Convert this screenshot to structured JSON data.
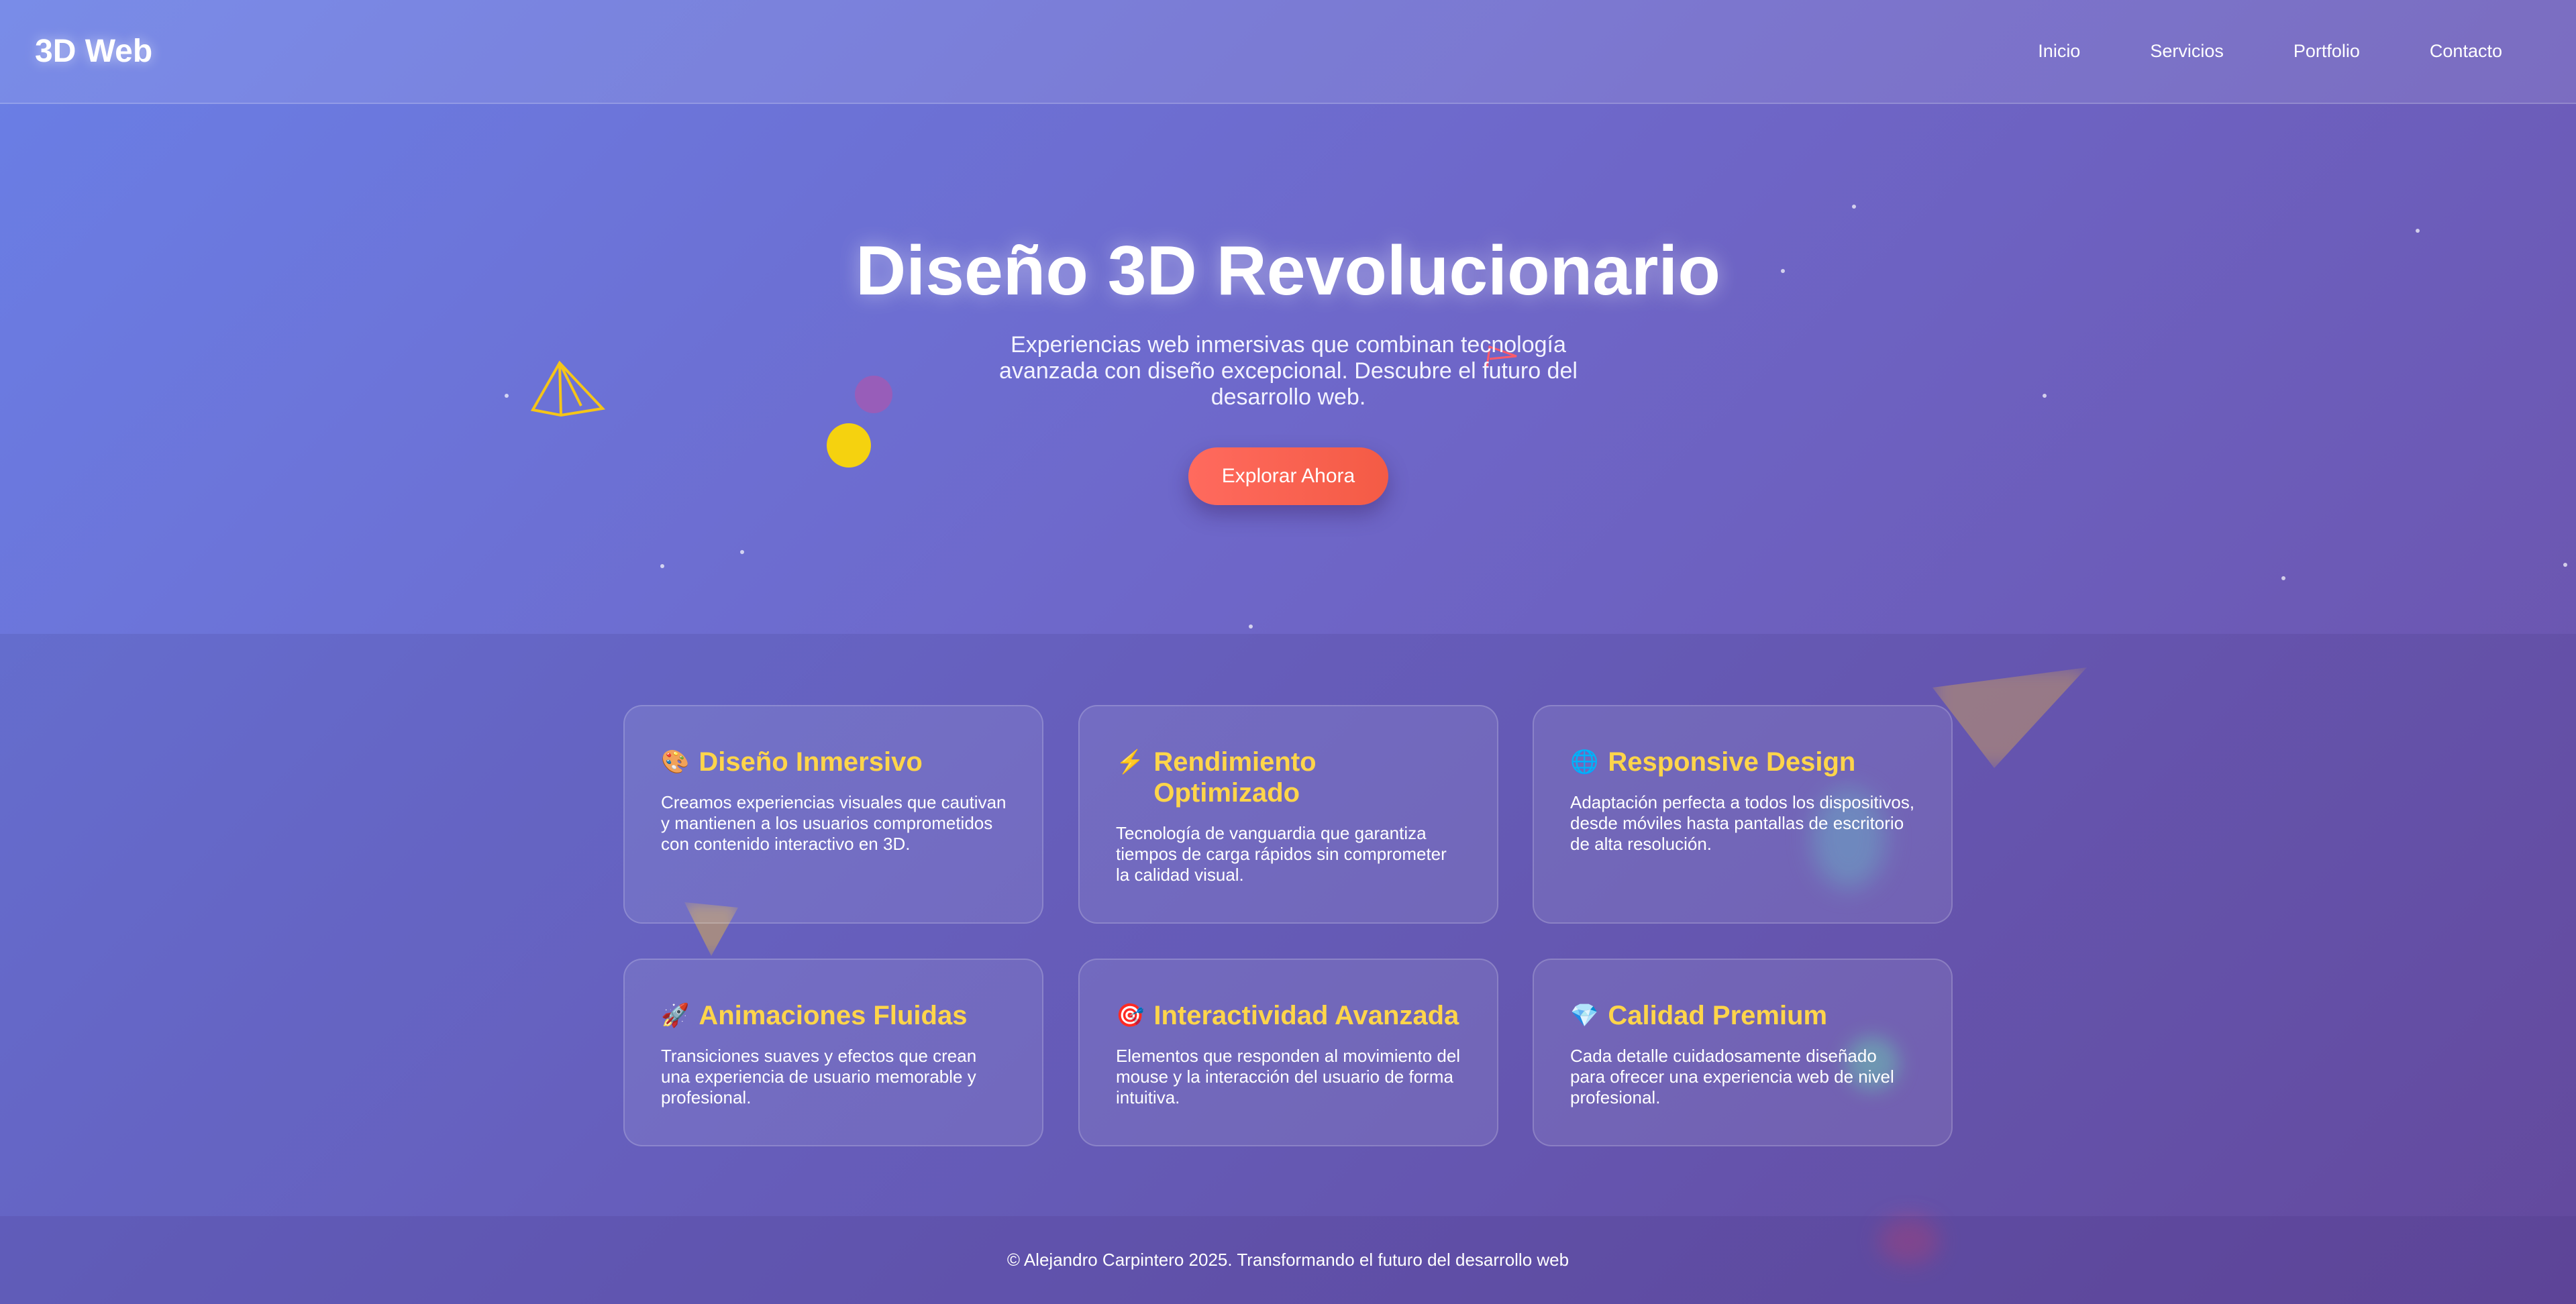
{
  "header": {
    "logo": "3D Web",
    "nav": [
      "Inicio",
      "Servicios",
      "Portfolio",
      "Contacto"
    ]
  },
  "hero": {
    "title": "Diseño 3D Revolucionario",
    "subtitle": "Experiencias web inmersivas que combinan tecnología avanzada con diseño excepcional. Descubre el futuro del desarrollo web.",
    "cta": "Explorar Ahora"
  },
  "services": [
    {
      "icon": "🎨",
      "icon_name": "palette-icon",
      "title": "Diseño Inmersivo",
      "text": "Creamos experiencias visuales que cautivan y mantienen a los usuarios comprometidos con contenido interactivo en 3D."
    },
    {
      "icon": "⚡",
      "icon_name": "lightning-icon",
      "title": "Rendimiento Optimizado",
      "text": "Tecnología de vanguardia que garantiza tiempos de carga rápidos sin comprometer la calidad visual."
    },
    {
      "icon": "🌐",
      "icon_name": "globe-icon",
      "title": "Responsive Design",
      "text": "Adaptación perfecta a todos los dispositivos, desde móviles hasta pantallas de escritorio de alta resolución."
    },
    {
      "icon": "🚀",
      "icon_name": "rocket-icon",
      "title": "Animaciones Fluidas",
      "text": "Transiciones suaves y efectos que crean una experiencia de usuario memorable y profesional."
    },
    {
      "icon": "🎯",
      "icon_name": "target-icon",
      "title": "Interactividad Avanzada",
      "text": "Elementos que responden al movimiento del mouse y la interacción del usuario de forma intuitiva."
    },
    {
      "icon": "💎",
      "icon_name": "gem-icon",
      "title": "Calidad Premium",
      "text": "Cada detalle cuidadosamente diseñado para ofrecer una experiencia web de nivel profesional."
    }
  ],
  "footer": {
    "text": "© Alejandro Carpintero 2025. Transformando el futuro del desarrollo web"
  },
  "colors": {
    "accent": "#ffd54a",
    "cta": "#f45b45",
    "bg_start": "#6a7fe6",
    "bg_end": "#6a4fa6"
  }
}
